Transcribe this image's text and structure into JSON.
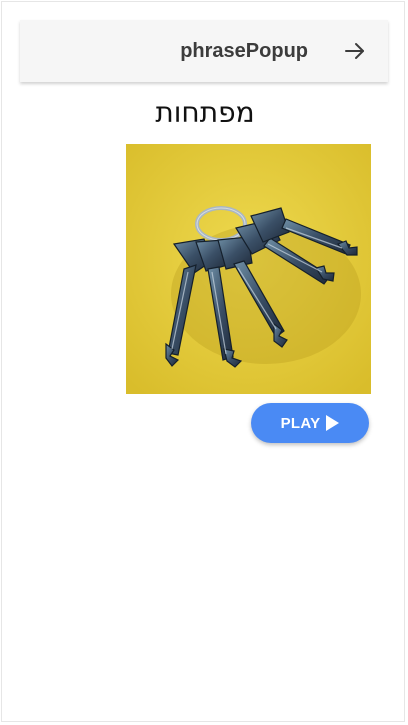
{
  "app_bar": {
    "title": "phrasePopup",
    "back_icon": "arrow-right-icon"
  },
  "phrase": {
    "word": "מפתחות",
    "image_icon": "keys-photo"
  },
  "play_button": {
    "label": "PLAY",
    "icon": "play-icon",
    "color": "#4a8af4"
  },
  "colors": {
    "app_bar_bg": "#f6f6f6",
    "photo_bg": "#e8cf3c"
  }
}
